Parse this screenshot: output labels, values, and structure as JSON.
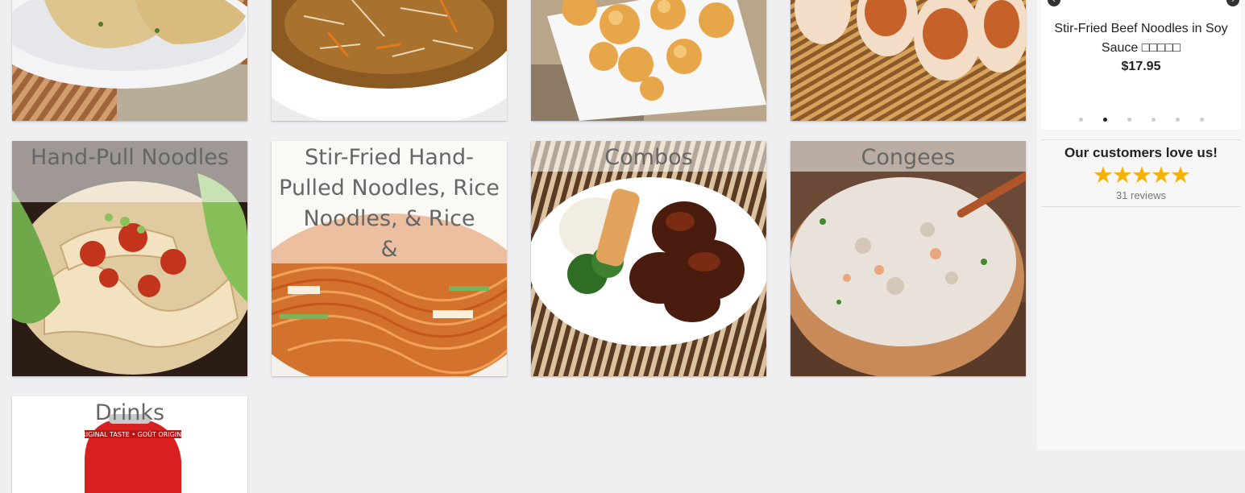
{
  "menu_categories": [
    {
      "label": ""
    },
    {
      "label": ""
    },
    {
      "label": ""
    },
    {
      "label": ""
    },
    {
      "label": "Hand-Pull Noodles"
    },
    {
      "label": "Stir-Fried Hand-Pulled Noodles, Rice Noodles, & Rice      &"
    },
    {
      "label": "Combos"
    },
    {
      "label": "Congees"
    },
    {
      "label": "Drinks"
    }
  ],
  "carousel": {
    "prev_icon": "chevron-left-icon",
    "next_icon": "chevron-right-icon",
    "item_name": "Stir-Fried Beef Noodles in Soy Sauce □□□□□",
    "item_price": "$17.95",
    "dot_count": 6,
    "active_dot": 2
  },
  "reviews": {
    "title": "Our customers love us!",
    "stars": "★★★★★",
    "rating": 5,
    "count_text": "31 reviews"
  },
  "colors": {
    "background": "#efeff1",
    "star": "#f5b301",
    "label_text": "#666666"
  }
}
